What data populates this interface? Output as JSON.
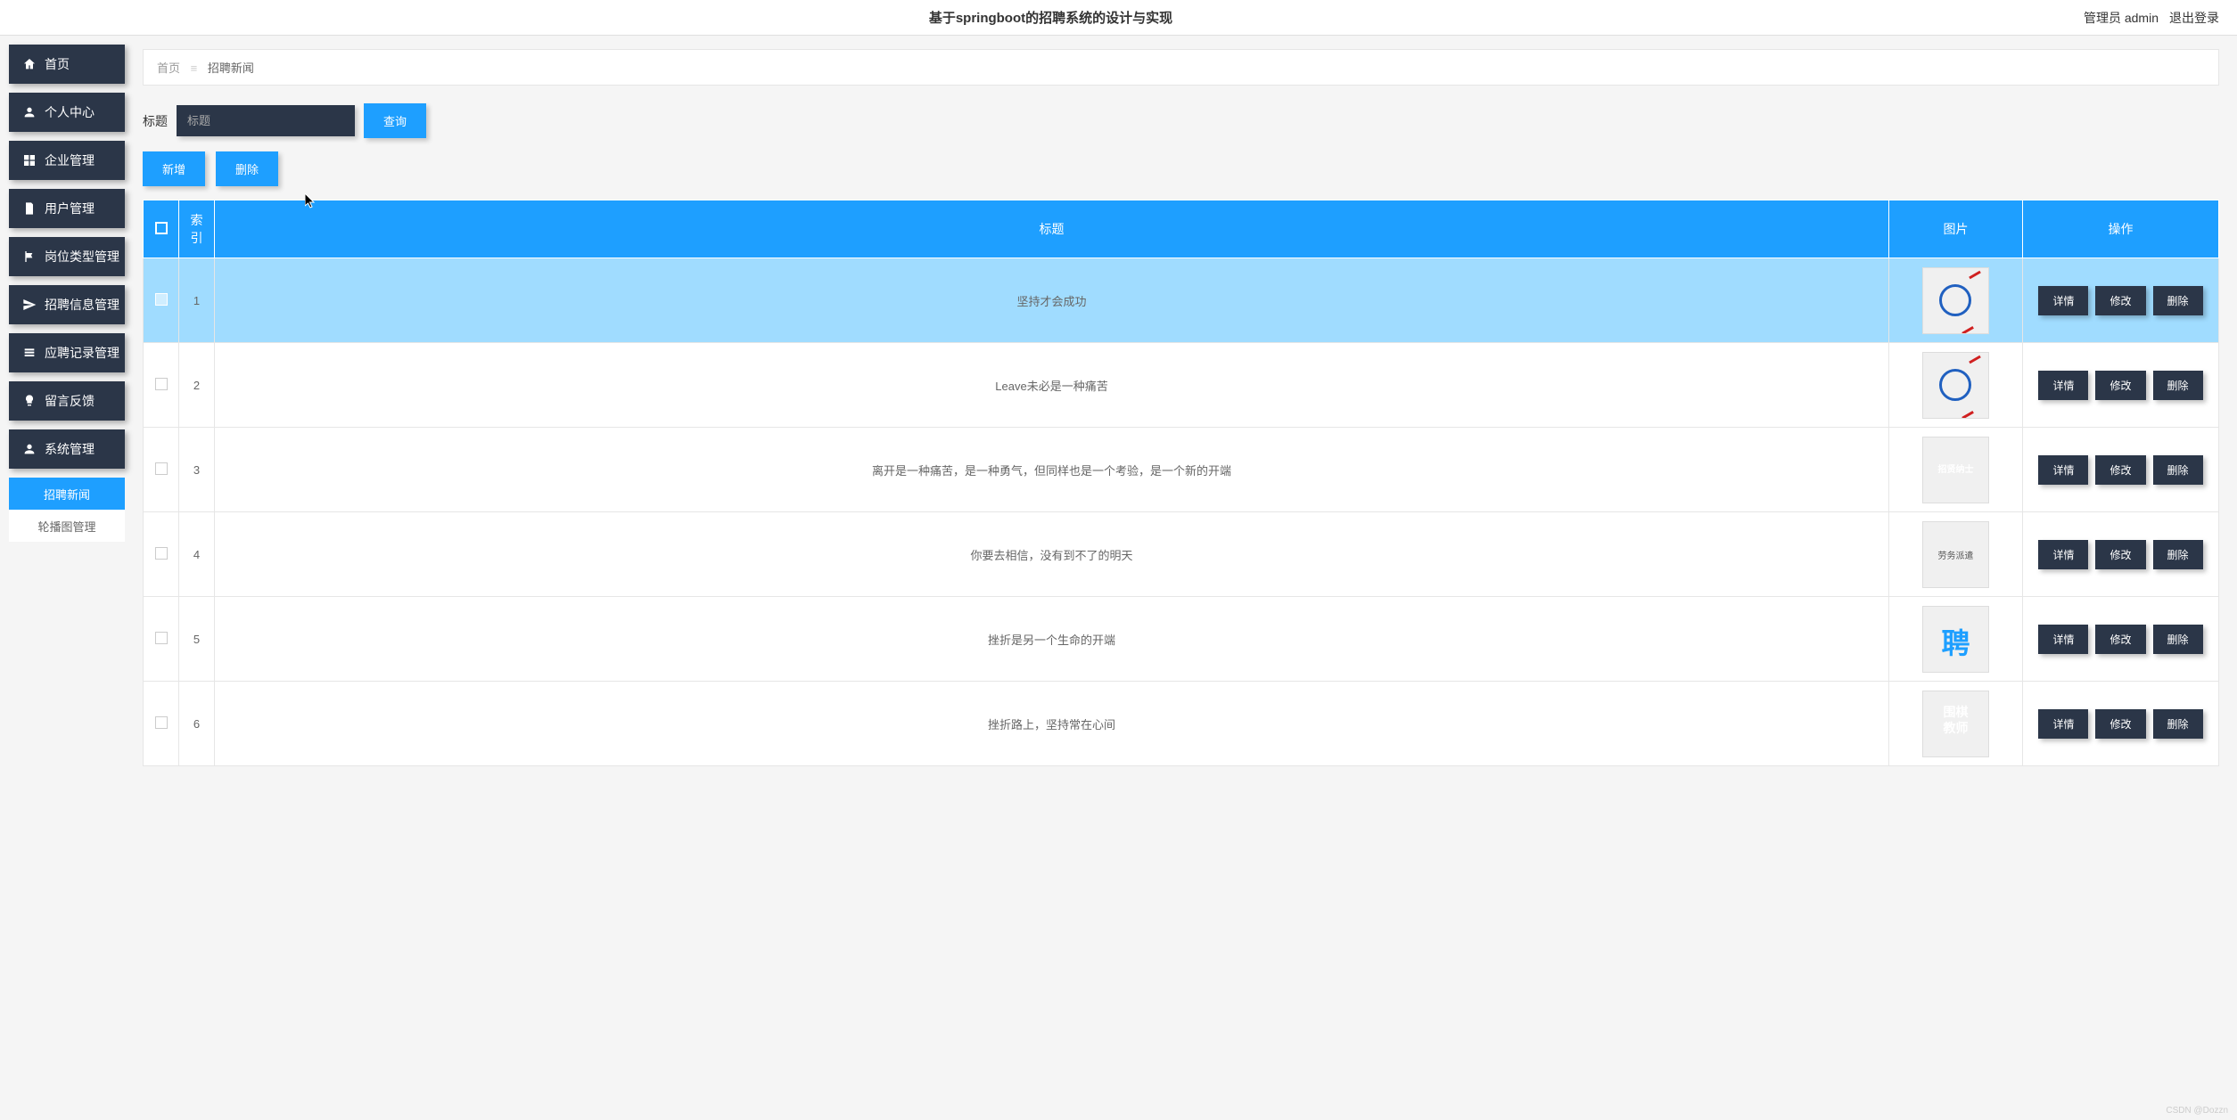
{
  "header": {
    "title": "基于springboot的招聘系统的设计与实现",
    "role_user": "管理员 admin",
    "logout": "退出登录"
  },
  "sidebar": {
    "items": [
      {
        "label": "首页",
        "icon": "home"
      },
      {
        "label": "个人中心",
        "icon": "user"
      },
      {
        "label": "企业管理",
        "icon": "grid"
      },
      {
        "label": "用户管理",
        "icon": "doc"
      },
      {
        "label": "岗位类型管理",
        "icon": "flag"
      },
      {
        "label": "招聘信息管理",
        "icon": "send"
      },
      {
        "label": "应聘记录管理",
        "icon": "list"
      },
      {
        "label": "留言反馈",
        "icon": "bulb"
      },
      {
        "label": "系统管理",
        "icon": "user"
      }
    ],
    "sub_items": [
      {
        "label": "招聘新闻",
        "active": true
      },
      {
        "label": "轮播图管理",
        "active": false
      }
    ]
  },
  "breadcrumb": {
    "home": "首页",
    "current": "招聘新闻"
  },
  "search": {
    "label": "标题",
    "placeholder": "标题",
    "button": "查询"
  },
  "actions": {
    "add": "新增",
    "delete": "删除"
  },
  "table": {
    "headers": {
      "index": "索引",
      "title": "标题",
      "image": "图片",
      "op": "操作"
    },
    "rows": [
      {
        "index": "1",
        "title": "坚持才会成功",
        "highlight": true,
        "thumb": "thumb-1"
      },
      {
        "index": "2",
        "title": "Leave未必是一种痛苦",
        "highlight": false,
        "thumb": "thumb-2"
      },
      {
        "index": "3",
        "title": "离开是一种痛苦，是一种勇气，但同样也是一个考验，是一个新的开端",
        "highlight": false,
        "thumb": "thumb-3"
      },
      {
        "index": "4",
        "title": "你要去相信，没有到不了的明天",
        "highlight": false,
        "thumb": "thumb-4"
      },
      {
        "index": "5",
        "title": "挫折是另一个生命的开端",
        "highlight": false,
        "thumb": "thumb-5"
      },
      {
        "index": "6",
        "title": "挫折路上，坚持常在心间",
        "highlight": false,
        "thumb": "thumb-6"
      }
    ],
    "op": {
      "detail": "详情",
      "edit": "修改",
      "delete": "删除"
    }
  },
  "watermark": "CSDN @Dozzn"
}
